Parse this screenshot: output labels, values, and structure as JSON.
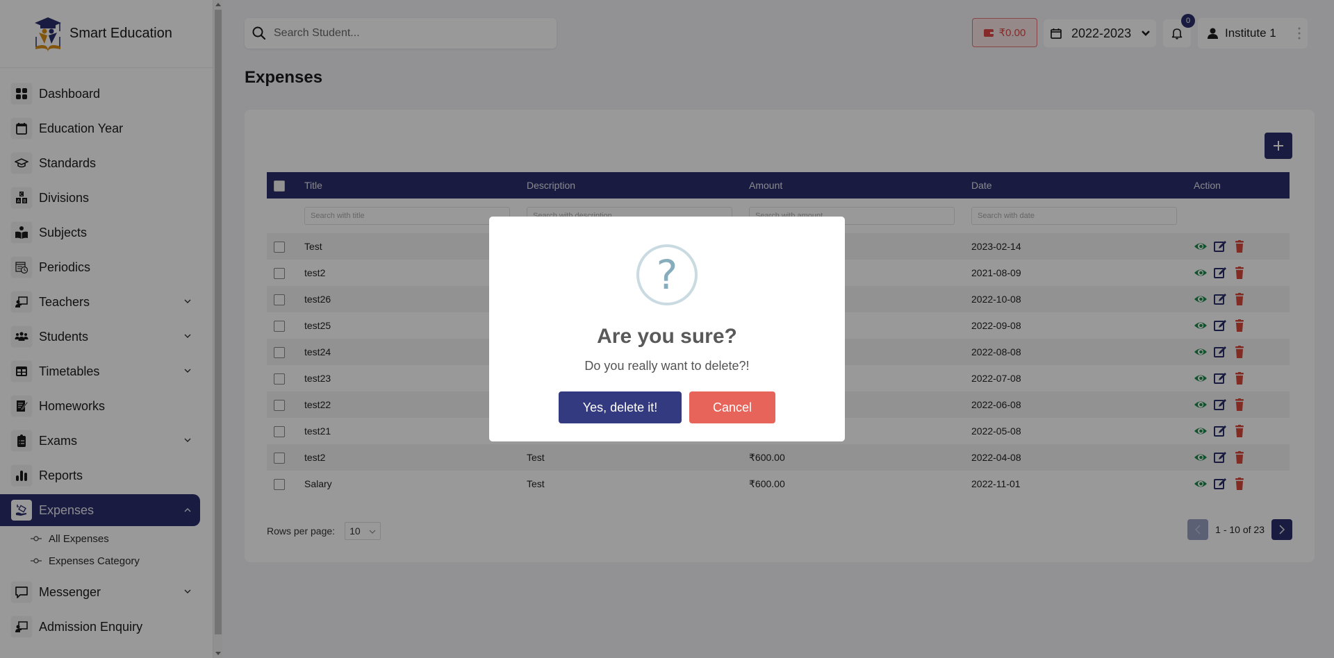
{
  "brand": {
    "name": "Smart Education"
  },
  "sidebar": {
    "items": [
      {
        "label": "Dashboard",
        "icon": "dashboard-icon",
        "expandable": false
      },
      {
        "label": "Education Year",
        "icon": "calendar-icon",
        "expandable": false
      },
      {
        "label": "Standards",
        "icon": "graduation-cap-icon",
        "expandable": false
      },
      {
        "label": "Divisions",
        "icon": "abc-blocks-icon",
        "expandable": false
      },
      {
        "label": "Subjects",
        "icon": "book-reader-icon",
        "expandable": false
      },
      {
        "label": "Periodics",
        "icon": "calendar-clock-icon",
        "expandable": false
      },
      {
        "label": "Teachers",
        "icon": "teacher-board-icon",
        "expandable": true
      },
      {
        "label": "Students",
        "icon": "users-icon",
        "expandable": true
      },
      {
        "label": "Timetables",
        "icon": "table-icon",
        "expandable": true
      },
      {
        "label": "Homeworks",
        "icon": "document-edit-icon",
        "expandable": false
      },
      {
        "label": "Exams",
        "icon": "clipboard-list-icon",
        "expandable": true
      },
      {
        "label": "Reports",
        "icon": "bar-chart-icon",
        "expandable": false
      },
      {
        "label": "Expenses",
        "icon": "hand-money-icon",
        "expandable": true,
        "active": true,
        "children": [
          {
            "label": "All Expenses"
          },
          {
            "label": "Expenses Category"
          }
        ]
      },
      {
        "label": "Messenger",
        "icon": "chat-icon",
        "expandable": true
      },
      {
        "label": "Admission Enquiry",
        "icon": "teacher-board-icon",
        "expandable": false
      }
    ]
  },
  "topbar": {
    "search_placeholder": "Search Student...",
    "wallet_amount": "₹0.00",
    "education_year": "2022-2023",
    "notification_count": "0",
    "user_name": "Institute 1"
  },
  "page": {
    "title": "Expenses"
  },
  "table": {
    "columns": [
      "Title",
      "Description",
      "Amount",
      "Date",
      "Action"
    ],
    "filters": {
      "title": "Search with title",
      "description": "Search with description",
      "amount": "Search with amount",
      "date": "Search with date"
    },
    "rows": [
      {
        "title": "Test",
        "description": "",
        "amount": "",
        "date": "2023-02-14"
      },
      {
        "title": "test2",
        "description": "",
        "amount": "",
        "date": "2021-08-09"
      },
      {
        "title": "test26",
        "description": "",
        "amount": "",
        "date": "2022-10-08"
      },
      {
        "title": "test25",
        "description": "",
        "amount": "",
        "date": "2022-09-08"
      },
      {
        "title": "test24",
        "description": "",
        "amount": "",
        "date": "2022-08-08"
      },
      {
        "title": "test23",
        "description": "",
        "amount": "",
        "date": "2022-07-08"
      },
      {
        "title": "test22",
        "description": "",
        "amount": "",
        "date": "2022-06-08"
      },
      {
        "title": "test21",
        "description": "",
        "amount": "",
        "date": "2022-05-08"
      },
      {
        "title": "test2",
        "description": "Test",
        "amount": "₹600.00",
        "date": "2022-04-08"
      },
      {
        "title": "Salary",
        "description": "Test",
        "amount": "₹600.00",
        "date": "2022-11-01"
      }
    ]
  },
  "pagination": {
    "rows_per_page_label": "Rows per page:",
    "rows_per_page": "10",
    "range_text": "1 - 10 of 23"
  },
  "modal": {
    "icon": "?",
    "title": "Are you sure?",
    "text": "Do you really want to delete?!",
    "confirm_label": "Yes, delete it!",
    "cancel_label": "Cancel"
  },
  "colors": {
    "primary": "#2b2f6b",
    "confirm": "#343a7f",
    "cancel": "#e6645a",
    "view": "#1f8a4c",
    "delete": "#d9483b"
  }
}
